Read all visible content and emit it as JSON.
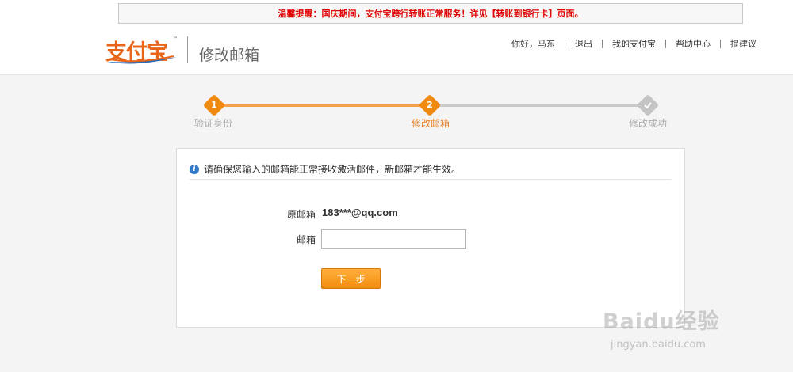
{
  "notice": {
    "text": "温馨提醒：国庆期间，支付宝跨行转账正常服务！详见【转账到银行卡】页面。"
  },
  "header": {
    "logo_text": "支付宝",
    "logo_tm": "™",
    "page_title": "修改邮箱",
    "nav": {
      "greeting": "你好，马东",
      "logout": "退出",
      "my_alipay": "我的支付宝",
      "help": "帮助中心",
      "feedback": "提建议"
    }
  },
  "steps": [
    {
      "num": "1",
      "label": "验证身份",
      "state": "done"
    },
    {
      "num": "2",
      "label": "修改邮箱",
      "state": "active"
    },
    {
      "num": "",
      "label": "修改成功",
      "state": "todo"
    }
  ],
  "form": {
    "info_icon_text": "i",
    "info_text": "请确保您输入的邮箱能正常接收激活邮件，新邮箱才能生效。",
    "old_email_label": "原邮箱",
    "old_email_value": "183***@qq.com",
    "new_email_label": "邮箱",
    "new_email_value": "",
    "next_button": "下一步"
  },
  "watermark": {
    "main": "Baidu经验",
    "sub": "jingyan.baidu.com"
  },
  "colors": {
    "accent": "#f0890f",
    "notice_red": "#e00000",
    "info_blue": "#2f79c8"
  }
}
